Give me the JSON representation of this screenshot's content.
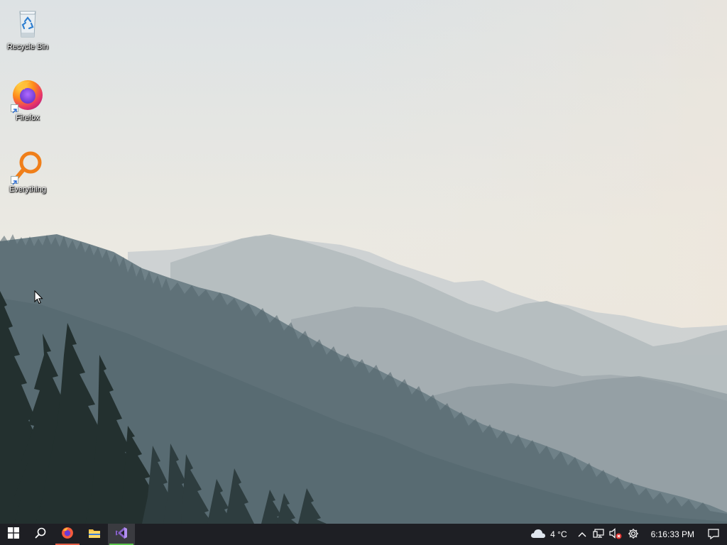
{
  "desktop": {
    "icons": [
      {
        "label": "Recycle Bin",
        "icon": "recycle-bin-icon"
      },
      {
        "label": "Firefox",
        "icon": "firefox-icon"
      },
      {
        "label": "Everything",
        "icon": "everything-search-icon"
      }
    ]
  },
  "taskbar": {
    "buttons": [
      {
        "name": "start",
        "icon": "windows-logo-icon"
      },
      {
        "name": "search",
        "icon": "search-icon"
      },
      {
        "name": "firefox",
        "icon": "firefox-icon",
        "running": true
      },
      {
        "name": "file-explorer",
        "icon": "folder-icon"
      },
      {
        "name": "visual-studio",
        "icon": "visual-studio-icon",
        "running": true
      }
    ],
    "tray": {
      "weather_temp": "4 °C",
      "weather_icon": "cloud-icon",
      "show_hidden_icon": "chevron-up-icon",
      "network_icon": "network-icon",
      "volume_icon": "volume-muted-icon",
      "settings_icon": "gear-icon",
      "clock": "6:16:33 PM",
      "notifications_icon": "notification-icon"
    }
  },
  "colors": {
    "taskbar": "#1e1f24",
    "firefox_indicator": "#e25e45",
    "vs_indicator": "#59c24a",
    "everything_orange": "#f07f1a"
  }
}
